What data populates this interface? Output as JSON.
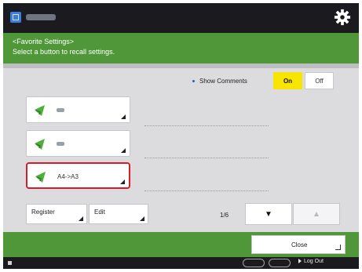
{
  "header": {
    "title_line1": "<Favorite Settings>",
    "title_line2": "Select a button to recall settings."
  },
  "comments": {
    "label": "Show Comments",
    "on_label": "On",
    "off_label": "Off",
    "selected": "On"
  },
  "favorites": [
    {
      "label": "",
      "selected": false
    },
    {
      "label": "",
      "selected": false
    },
    {
      "label": "A4->A3",
      "selected": true
    }
  ],
  "actions": {
    "register_label": "Register",
    "edit_label": "Edit"
  },
  "pagination": {
    "indicator": "1/6",
    "down_glyph": "▼",
    "up_glyph": "▲"
  },
  "footer": {
    "close_label": "Close"
  },
  "statusbar": {
    "logout_label": "Log Out"
  },
  "colors": {
    "header_green": "#4f9738",
    "selected_outline": "#d41c2a",
    "on_yellow": "#f7e400",
    "dark_bar": "#1b1b1f"
  },
  "icons": [
    "app-icon",
    "gear-icon",
    "favorite-icon",
    "corner-arrow-icon",
    "logout-icon"
  ]
}
